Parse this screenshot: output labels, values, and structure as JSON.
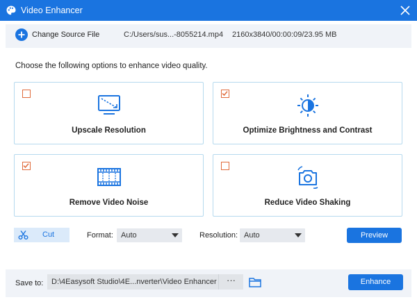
{
  "window": {
    "title": "Video Enhancer",
    "accent": "#1a74e0"
  },
  "source": {
    "change_label": "Change Source File",
    "path": "C:/Users/sus...-8055214.mp4",
    "info": "2160x3840/00:00:09/23.95 MB"
  },
  "instruction": "Choose the following options to enhance video quality.",
  "options": [
    {
      "label": "Upscale Resolution",
      "checked": false,
      "icon": "monitor-upscale-icon"
    },
    {
      "label": "Optimize Brightness and Contrast",
      "checked": true,
      "icon": "brightness-icon"
    },
    {
      "label": "Remove Video Noise",
      "checked": true,
      "icon": "film-denoise-icon"
    },
    {
      "label": "Reduce Video Shaking",
      "checked": false,
      "icon": "camera-stabilize-icon"
    }
  ],
  "controls": {
    "cut_label": "Cut",
    "format_label": "Format:",
    "format_value": "Auto",
    "resolution_label": "Resolution:",
    "resolution_value": "Auto",
    "preview_label": "Preview"
  },
  "save": {
    "label": "Save to:",
    "path": "D:\\4Easysoft Studio\\4E...nverter\\Video Enhancer",
    "dots": "···",
    "enhance_label": "Enhance"
  }
}
